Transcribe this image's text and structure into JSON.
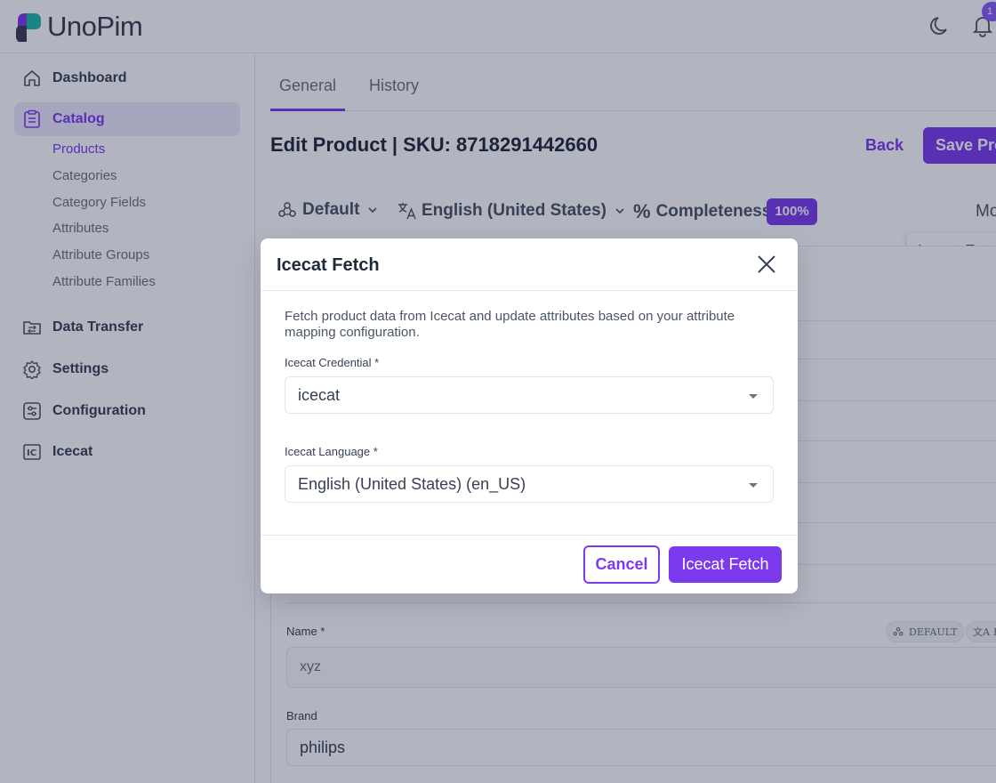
{
  "app": {
    "name": "UnoPim",
    "notification_count": "1"
  },
  "sidebar": {
    "items": [
      {
        "label": "Dashboard"
      },
      {
        "label": "Catalog"
      },
      {
        "label": "Data Transfer"
      },
      {
        "label": "Settings"
      },
      {
        "label": "Configuration"
      },
      {
        "label": "Icecat"
      }
    ],
    "catalog_sub": [
      "Products",
      "Categories",
      "Category Fields",
      "Attributes",
      "Attribute Groups",
      "Attribute Families"
    ]
  },
  "tabs": [
    "General",
    "History"
  ],
  "page": {
    "title": "Edit Product | SKU: 8718291442660",
    "back_label": "Back",
    "save_label": "Save Product"
  },
  "toolbar": {
    "channel": "Default",
    "locale": "English (United States)",
    "completeness_label": "Completeness",
    "completeness_value": "100%",
    "more_label": "More"
  },
  "more_menu": {
    "item": "Icecat Fetch"
  },
  "form": {
    "name_label": "Name *",
    "name_value": "xyz",
    "chip_default": "DEFAULT",
    "chip_locale": "EN",
    "brand_label": "Brand",
    "brand_value": "philips"
  },
  "modal": {
    "title": "Icecat Fetch",
    "description": "Fetch product data from Icecat and update attributes based on your attribute mapping configuration.",
    "credential_label": "Icecat Credential *",
    "credential_value": "icecat",
    "language_label": "Icecat Language *",
    "language_value": "English (United States) (en_US)",
    "cancel_label": "Cancel",
    "submit_label": "Icecat Fetch"
  },
  "colors": {
    "accent": "#7c3aed",
    "accent_light": "#ede9fe"
  }
}
